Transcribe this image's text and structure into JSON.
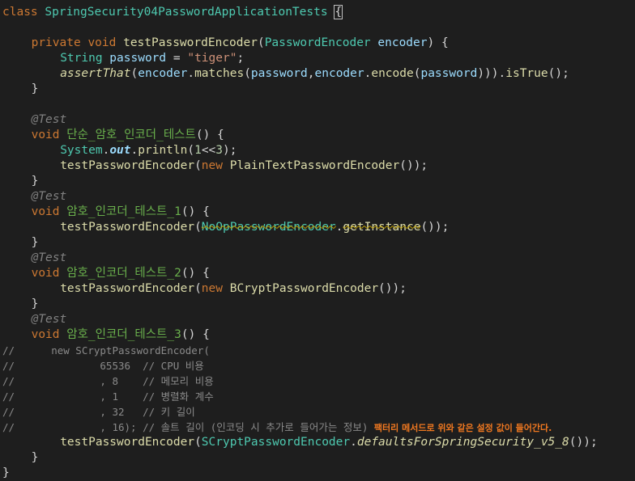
{
  "editor": {
    "lines": [
      {
        "indent": 0,
        "tokens": [
          {
            "t": "class ",
            "c": "kw"
          },
          {
            "t": "SpringSecurity04PasswordApplicationTests",
            "c": "cls"
          },
          {
            "t": " ",
            "c": "plain"
          },
          {
            "t": "{",
            "c": "plain brace-box"
          }
        ]
      },
      {
        "indent": 0,
        "tokens": []
      },
      {
        "indent": 1,
        "tokens": [
          {
            "t": "private ",
            "c": "kw"
          },
          {
            "t": "void ",
            "c": "kw"
          },
          {
            "t": "testPasswordEncoder",
            "c": "fn"
          },
          {
            "t": "(",
            "c": "plain"
          },
          {
            "t": "PasswordEncoder ",
            "c": "cls"
          },
          {
            "t": "encoder",
            "c": "var"
          },
          {
            "t": ") {",
            "c": "plain"
          }
        ]
      },
      {
        "indent": 2,
        "tokens": [
          {
            "t": "String ",
            "c": "cls"
          },
          {
            "t": "password",
            "c": "var"
          },
          {
            "t": " = ",
            "c": "plain"
          },
          {
            "t": "\"tiger\"",
            "c": "str"
          },
          {
            "t": ";",
            "c": "plain"
          }
        ]
      },
      {
        "indent": 2,
        "tokens": [
          {
            "t": "assertThat",
            "c": "fn italic"
          },
          {
            "t": "(",
            "c": "plain"
          },
          {
            "t": "encoder",
            "c": "var"
          },
          {
            "t": ".",
            "c": "plain"
          },
          {
            "t": "matches",
            "c": "fn"
          },
          {
            "t": "(",
            "c": "plain"
          },
          {
            "t": "password",
            "c": "var"
          },
          {
            "t": ",",
            "c": "plain"
          },
          {
            "t": "encoder",
            "c": "var"
          },
          {
            "t": ".",
            "c": "plain"
          },
          {
            "t": "encode",
            "c": "fn"
          },
          {
            "t": "(",
            "c": "plain"
          },
          {
            "t": "password",
            "c": "var"
          },
          {
            "t": "))).",
            "c": "plain"
          },
          {
            "t": "isTrue",
            "c": "fn"
          },
          {
            "t": "();",
            "c": "plain"
          }
        ]
      },
      {
        "indent": 1,
        "tokens": [
          {
            "t": "}",
            "c": "plain"
          }
        ]
      },
      {
        "indent": 0,
        "tokens": []
      },
      {
        "indent": 1,
        "tokens": [
          {
            "t": "@Test",
            "c": "ann"
          }
        ]
      },
      {
        "indent": 1,
        "tokens": [
          {
            "t": "void ",
            "c": "kw"
          },
          {
            "t": "단순_암호_인코더_테스트",
            "c": "kfn"
          },
          {
            "t": "() {",
            "c": "plain"
          }
        ]
      },
      {
        "indent": 2,
        "tokens": [
          {
            "t": "System",
            "c": "cls"
          },
          {
            "t": ".",
            "c": "plain"
          },
          {
            "t": "out",
            "c": "var italic bold"
          },
          {
            "t": ".",
            "c": "plain"
          },
          {
            "t": "println",
            "c": "fn"
          },
          {
            "t": "(",
            "c": "plain"
          },
          {
            "t": "1",
            "c": "num"
          },
          {
            "t": "<<",
            "c": "plain"
          },
          {
            "t": "3",
            "c": "num"
          },
          {
            "t": ");",
            "c": "plain"
          }
        ]
      },
      {
        "indent": 2,
        "tokens": [
          {
            "t": "testPasswordEncoder",
            "c": "fn"
          },
          {
            "t": "(",
            "c": "plain"
          },
          {
            "t": "new ",
            "c": "kw"
          },
          {
            "t": "PlainTextPasswordEncoder",
            "c": "fn"
          },
          {
            "t": "());",
            "c": "plain"
          }
        ]
      },
      {
        "indent": 1,
        "tokens": [
          {
            "t": "}",
            "c": "plain"
          }
        ]
      },
      {
        "indent": 1,
        "tokens": [
          {
            "t": "@Test",
            "c": "ann"
          }
        ]
      },
      {
        "indent": 1,
        "tokens": [
          {
            "t": "void ",
            "c": "kw"
          },
          {
            "t": "암호_인코더_테스트_1",
            "c": "kfn"
          },
          {
            "t": "() {",
            "c": "plain"
          }
        ]
      },
      {
        "indent": 2,
        "tokens": [
          {
            "t": "testPasswordEncoder",
            "c": "fn"
          },
          {
            "t": "(",
            "c": "plain"
          },
          {
            "t": "NoOpPasswordEncoder",
            "c": "cls deprecated"
          },
          {
            "t": ".",
            "c": "plain"
          },
          {
            "t": "getInstance",
            "c": "fn deprecated"
          },
          {
            "t": "());",
            "c": "plain"
          }
        ]
      },
      {
        "indent": 1,
        "tokens": [
          {
            "t": "}",
            "c": "plain"
          }
        ]
      },
      {
        "indent": 1,
        "tokens": [
          {
            "t": "@Test",
            "c": "ann"
          }
        ]
      },
      {
        "indent": 1,
        "tokens": [
          {
            "t": "void ",
            "c": "kw"
          },
          {
            "t": "암호_인코더_테스트_2",
            "c": "kfn"
          },
          {
            "t": "() {",
            "c": "plain"
          }
        ]
      },
      {
        "indent": 2,
        "tokens": [
          {
            "t": "testPasswordEncoder",
            "c": "fn"
          },
          {
            "t": "(",
            "c": "plain"
          },
          {
            "t": "new ",
            "c": "kw"
          },
          {
            "t": "BCryptPasswordEncoder",
            "c": "fn"
          },
          {
            "t": "());",
            "c": "plain"
          }
        ]
      },
      {
        "indent": 1,
        "tokens": [
          {
            "t": "}",
            "c": "plain"
          }
        ]
      },
      {
        "indent": 1,
        "tokens": [
          {
            "t": "@Test",
            "c": "ann"
          }
        ]
      },
      {
        "indent": 1,
        "tokens": [
          {
            "t": "void ",
            "c": "kw"
          },
          {
            "t": "암호_인코더_테스트_3",
            "c": "kfn"
          },
          {
            "t": "() {",
            "c": "plain"
          }
        ]
      },
      {
        "indent": 0,
        "tokens": [
          {
            "t": "//      new SCryptPasswordEncoder(",
            "c": "cmt"
          }
        ]
      },
      {
        "indent": 0,
        "tokens": [
          {
            "t": "//              65536  // CPU 비용",
            "c": "cmt"
          }
        ]
      },
      {
        "indent": 0,
        "tokens": [
          {
            "t": "//              , 8    // 메모리 비용",
            "c": "cmt"
          }
        ]
      },
      {
        "indent": 0,
        "tokens": [
          {
            "t": "//              , 1    // 병렬화 계수",
            "c": "cmt"
          }
        ]
      },
      {
        "indent": 0,
        "tokens": [
          {
            "t": "//              , 32   // 키 길이",
            "c": "cmt"
          }
        ]
      },
      {
        "indent": 0,
        "tokens": [
          {
            "t": "//              , 16); // 솔트 길이 (인코딩 시 추가로 들어가는 정보) ",
            "c": "cmt"
          },
          {
            "t": "팩터리 메서드로 위와 같은 설정 값이 들어간다.",
            "c": "note"
          }
        ]
      },
      {
        "indent": 2,
        "tokens": [
          {
            "t": "testPasswordEncoder",
            "c": "fn"
          },
          {
            "t": "(",
            "c": "plain"
          },
          {
            "t": "SCryptPasswordEncoder",
            "c": "cls"
          },
          {
            "t": ".",
            "c": "plain"
          },
          {
            "t": "defaultsForSpringSecurity_v5_8",
            "c": "fn italic"
          },
          {
            "t": "());",
            "c": "plain"
          }
        ]
      },
      {
        "indent": 1,
        "tokens": [
          {
            "t": "}",
            "c": "plain"
          }
        ]
      },
      {
        "indent": 0,
        "tokens": [
          {
            "t": "}",
            "c": "plain"
          }
        ]
      }
    ]
  }
}
